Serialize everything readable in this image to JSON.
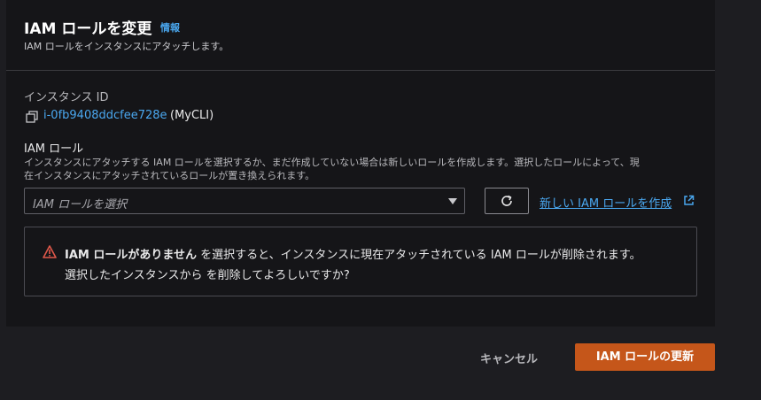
{
  "header": {
    "title": "IAM ロールを変更",
    "info_link": "情報",
    "subtitle": "IAM ロールをインスタンスにアタッチします。"
  },
  "instance": {
    "label": "インスタンス ID",
    "id": "i-0fb9408ddcfee728e",
    "name": "(MyCLI)"
  },
  "iam_role": {
    "label": "IAM ロール",
    "description_line1": "インスタンスにアタッチする IAM ロールを選択するか、まだ作成していない場合は新しいロールを作成します。選択したロールによって、現",
    "description_line2": "在インスタンスにアタッチされているロールが置き換えられます。",
    "select_placeholder": "IAM ロールを選択",
    "create_link": "新しい IAM ロールを作成"
  },
  "alert": {
    "line1_bold": "IAM ロールがありません",
    "line1_rest": " を選択すると、インスタンスに現在アタッチされている IAM ロールが削除されます。",
    "line2": "選択したインスタンスから を削除してよろしいですか?"
  },
  "footer": {
    "cancel_label": "キャンセル",
    "submit_label": "IAM ロールの更新"
  },
  "colors": {
    "link": "#4aa8f0",
    "primary": "#c5561a",
    "warning": "#e0584a"
  }
}
